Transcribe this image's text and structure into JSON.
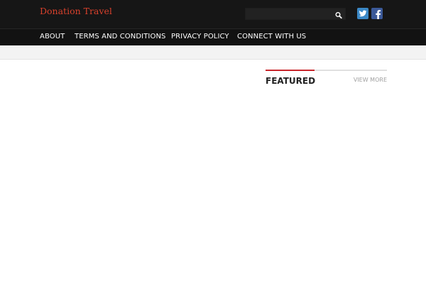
{
  "header": {
    "site_title": "Donation Travel",
    "search": {
      "placeholder": ""
    },
    "icons": {
      "search": "search-icon",
      "twitter": "twitter-icon",
      "facebook": "facebook-icon"
    },
    "colors": {
      "background": "#161616",
      "title": "#d9412c",
      "twitter": "#3b88c6",
      "facebook": "#3b5998"
    }
  },
  "nav": {
    "items": [
      {
        "label": "ABOUT"
      },
      {
        "label": "TERMS AND CONDITIONS"
      },
      {
        "label": "PRIVACY POLICY"
      },
      {
        "label": "CONNECT WITH US"
      }
    ]
  },
  "sidebar": {
    "featured": {
      "title": "FEATURED",
      "view_more": "VIEW MORE",
      "accent_color": "#c8262c"
    }
  }
}
